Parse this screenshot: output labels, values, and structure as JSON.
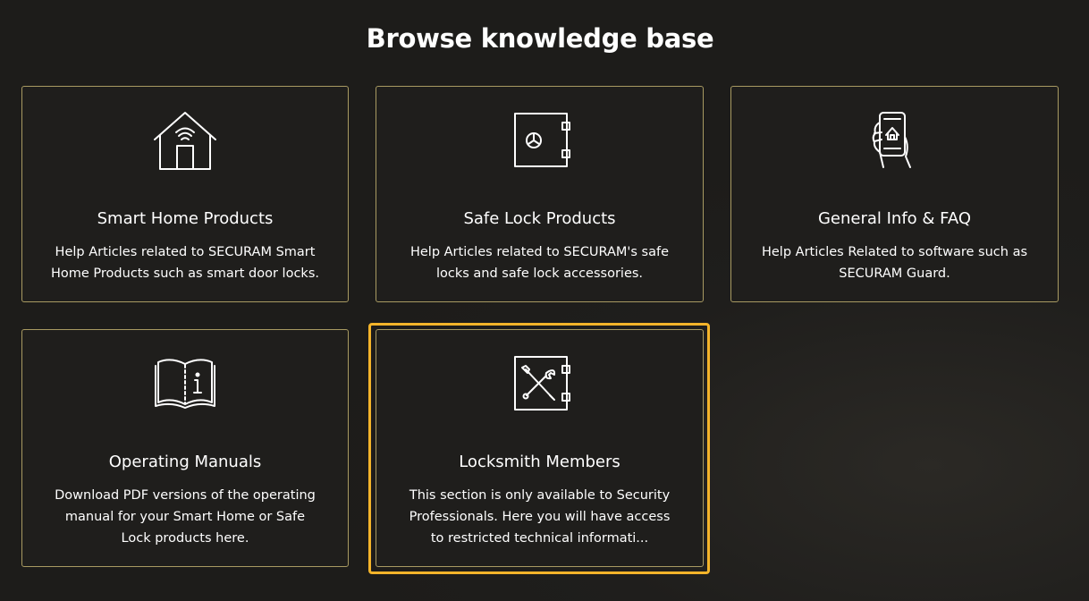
{
  "page": {
    "title": "Browse knowledge base",
    "accent_color": "#f4b42a",
    "card_border_color": "#a89a62"
  },
  "cards": [
    {
      "title": "Smart Home Products",
      "description": "Help Articles related to SECURAM Smart Home Products such as smart door locks.",
      "icon": "smart-home-icon"
    },
    {
      "title": "Safe Lock Products",
      "description": "Help Articles related to SECURAM's safe locks and safe lock accessories.",
      "icon": "safe-icon"
    },
    {
      "title": "General Info & FAQ",
      "description": "Help Articles Related to software such as SECURAM Guard.",
      "icon": "phone-in-hand-icon"
    },
    {
      "title": "Operating Manuals",
      "description": "Download PDF versions of the operating manual for your Smart Home or Safe Lock products here.",
      "icon": "manual-book-icon"
    },
    {
      "title": "Locksmith Members",
      "description": "This section is only available to Security Professionals. Here you will have access to restricted technical informati...",
      "icon": "locksmith-tools-icon",
      "focused": true
    }
  ]
}
